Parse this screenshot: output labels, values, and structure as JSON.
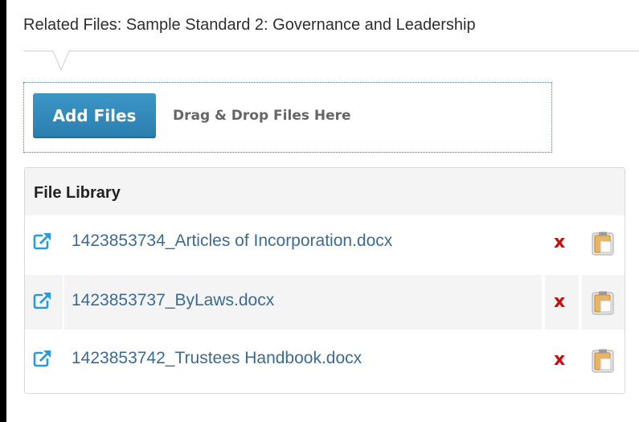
{
  "panel": {
    "title": "Related Files: Sample Standard 2: Governance and Leadership"
  },
  "upload": {
    "add_button_label": "Add Files",
    "drop_hint": "Drag & Drop Files Here"
  },
  "library": {
    "title": "File Library",
    "files": [
      {
        "name": "1423853734_Articles of Incorporation.docx"
      },
      {
        "name": "1423853737_ByLaws.docx"
      },
      {
        "name": "1423853742_Trustees Handbook.docx"
      }
    ],
    "icons": {
      "open": "external-link-icon",
      "delete": "delete-icon",
      "copy": "clipboard-copy-icon"
    },
    "delete_glyph": "x"
  },
  "colors": {
    "accent_button": "#2e86b8",
    "link": "#3a6b96",
    "delete": "#c40d0d",
    "icon_blue": "#2a9bd6"
  }
}
